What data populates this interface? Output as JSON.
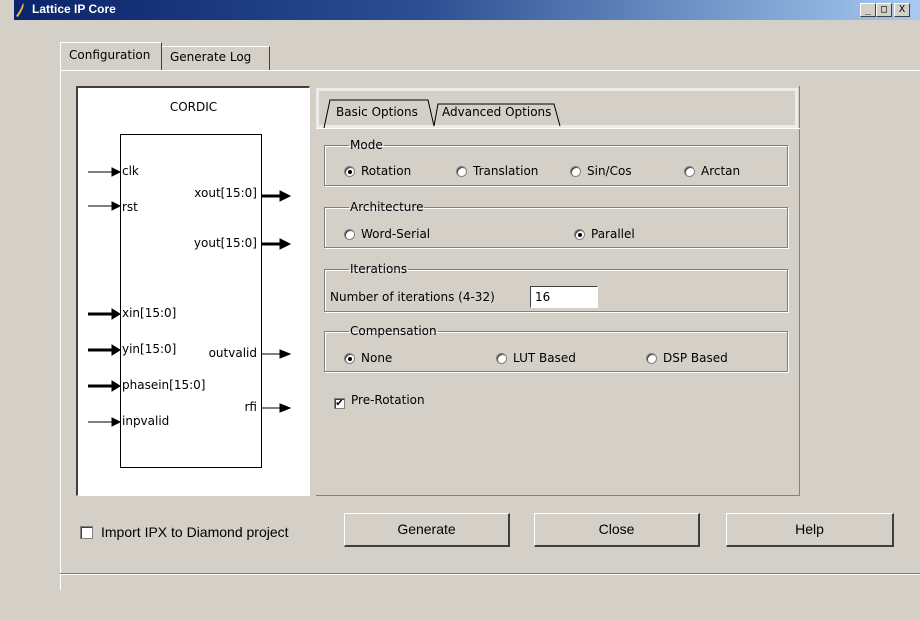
{
  "window": {
    "title": "Lattice IP Core",
    "controls": [
      "_",
      "□",
      "X"
    ]
  },
  "outer_tabs": [
    "Configuration",
    "Generate Log"
  ],
  "diagram": {
    "title": "CORDIC",
    "inputs": [
      "clk",
      "rst",
      "xin[15:0]",
      "yin[15:0]",
      "phasein[15:0]",
      "inpvalid"
    ],
    "outputs": [
      "xout[15:0]",
      "yout[15:0]",
      "outvalid",
      "rfi"
    ]
  },
  "inner_tabs": [
    "Basic Options",
    "Advanced Options"
  ],
  "mode": {
    "legend": "Mode",
    "options": [
      "Rotation",
      "Translation",
      "Sin/Cos",
      "Arctan"
    ],
    "selected": "Rotation"
  },
  "architecture": {
    "legend": "Architecture",
    "options": [
      "Word-Serial",
      "Parallel"
    ],
    "selected": "Parallel"
  },
  "iterations": {
    "legend": "Iterations",
    "label": "Number of iterations (4-32)",
    "value": "16"
  },
  "compensation": {
    "legend": "Compensation",
    "options": [
      "None",
      "LUT Based",
      "DSP Based"
    ],
    "selected": "None"
  },
  "pre_rotation": {
    "label": "Pre-Rotation",
    "checked": true
  },
  "bottom": {
    "import_label": "Import IPX to Diamond project",
    "import_checked": false,
    "generate": "Generate",
    "close": "Close",
    "help": "Help"
  }
}
